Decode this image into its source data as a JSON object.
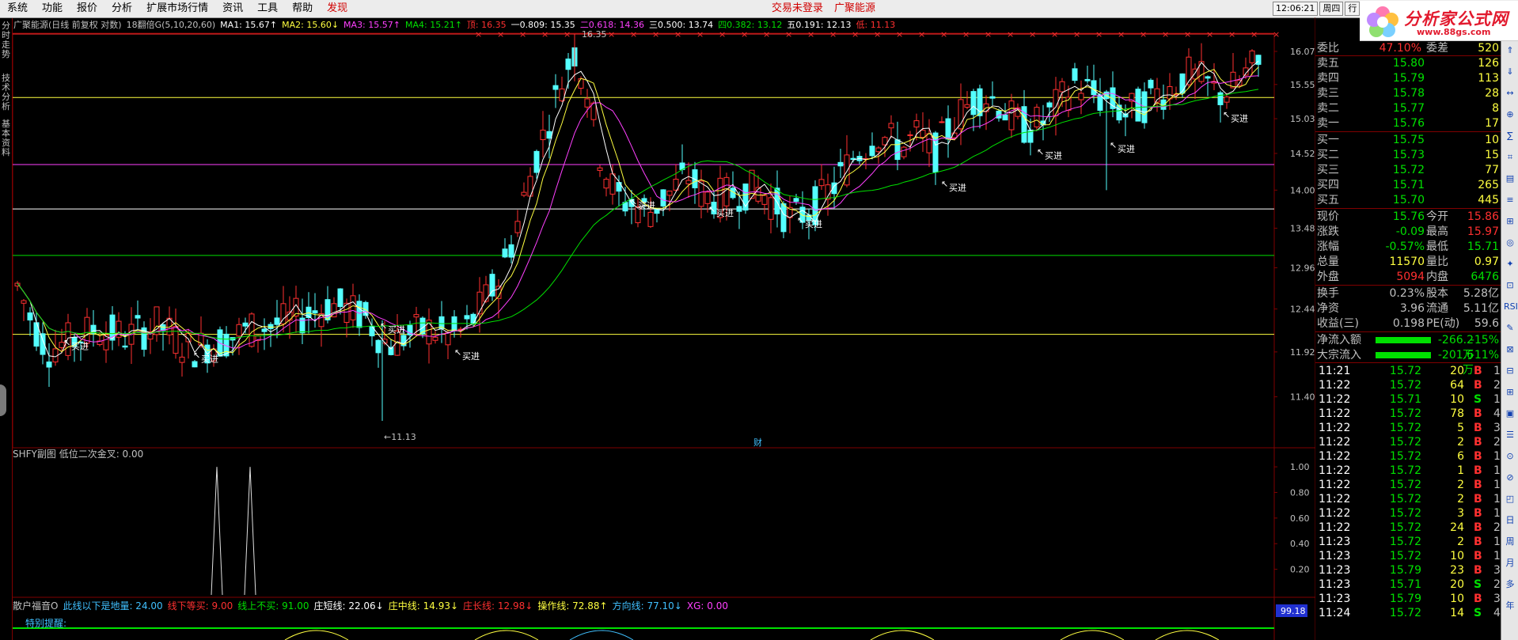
{
  "menu": [
    "系统",
    "功能",
    "报价",
    "分析",
    "扩展市场行情",
    "资讯",
    "工具",
    "帮助"
  ],
  "menu_discover": "发现",
  "menu_center": [
    "交易未登录",
    "广聚能源"
  ],
  "clock": {
    "time": "12:06:21",
    "weekday": "周四",
    "tab": "行"
  },
  "logo": {
    "title": "分析家公式网",
    "url": "www.88gs.com"
  },
  "left_tabs": [
    "分时走势",
    "技术分析",
    "基本资料"
  ],
  "header": {
    "stock": "广聚能源(日线 前复权 对数)",
    "rule": "18翻倍G(5,10,20,60)",
    "ma": [
      {
        "label": "MA1: 15.67",
        "arrow": "↑",
        "color": "#ffffff"
      },
      {
        "label": "MA2: 15.60",
        "arrow": "↓",
        "color": "#ffff40"
      },
      {
        "label": "MA3: 15.57",
        "arrow": "↑",
        "color": "#ff40ff"
      },
      {
        "label": "MA4: 15.21",
        "arrow": "↑",
        "color": "#00e000"
      }
    ],
    "levels": [
      {
        "label": "顶: 16.35",
        "color": "#ff3030"
      },
      {
        "label": "一0.809: 15.35",
        "color": "#ffffff"
      },
      {
        "label": "二0.618: 14.36",
        "color": "#ff40ff"
      },
      {
        "label": "三0.500: 13.74",
        "color": "#ffffff"
      },
      {
        "label": "四0.382: 13.12",
        "color": "#00e000"
      },
      {
        "label": "五0.191: 12.13",
        "color": "#ffffff"
      },
      {
        "label": "低: 11.13",
        "color": "#ff3030"
      }
    ]
  },
  "price_axis": [
    "16.07",
    "15.55",
    "15.03",
    "14.52",
    "14.00",
    "13.48",
    "12.96",
    "12.44",
    "11.92",
    "11.40"
  ],
  "annotations": {
    "high": "16.35",
    "low": "←11.13",
    "buy": "买进",
    "cai": "财"
  },
  "indicator1": {
    "title": "SHFY副图 低位二次金叉: 0.00",
    "axis": [
      "1.00",
      "0.80",
      "0.60",
      "0.40",
      "0.20"
    ]
  },
  "indicator2": {
    "items": [
      {
        "label": "散户福音O",
        "color": "#c0c0c0"
      },
      {
        "label": "此线以下是地量: 24.00",
        "color": "#40c0ff"
      },
      {
        "label": "线下等买: 9.00",
        "color": "#ff3030"
      },
      {
        "label": "线上不买: 91.00",
        "color": "#00e000"
      },
      {
        "label": "庄短线: 22.06↓",
        "color": "#ffffff"
      },
      {
        "label": "庄中线: 14.93↓",
        "color": "#ffff40"
      },
      {
        "label": "庄长线: 12.98↓",
        "color": "#ff3030"
      },
      {
        "label": "操作线: 72.88↑",
        "color": "#ffff40"
      },
      {
        "label": "方向线: 77.10↓",
        "color": "#40c0ff"
      },
      {
        "label": "XG: 0.00",
        "color": "#ff40ff"
      }
    ],
    "remind": "特别提醒:",
    "value_box": "99.18"
  },
  "quote": {
    "weibi": {
      "label": "委比",
      "value": "47.10%",
      "label2": "委差",
      "value2": "520"
    },
    "asks": [
      {
        "label": "卖五",
        "price": "15.80",
        "vol": "126"
      },
      {
        "label": "卖四",
        "price": "15.79",
        "vol": "113"
      },
      {
        "label": "卖三",
        "price": "15.78",
        "vol": "28"
      },
      {
        "label": "卖二",
        "price": "15.77",
        "vol": "8"
      },
      {
        "label": "卖一",
        "price": "15.76",
        "vol": "17"
      }
    ],
    "bids": [
      {
        "label": "买一",
        "price": "15.75",
        "vol": "10"
      },
      {
        "label": "买二",
        "price": "15.73",
        "vol": "15"
      },
      {
        "label": "买三",
        "price": "15.72",
        "vol": "77"
      },
      {
        "label": "买四",
        "price": "15.71",
        "vol": "265"
      },
      {
        "label": "买五",
        "price": "15.70",
        "vol": "445"
      }
    ],
    "stats": [
      {
        "l1": "现价",
        "v1": "15.76",
        "c1": "#00e000",
        "l2": "今开",
        "v2": "15.86",
        "c2": "#ff3030"
      },
      {
        "l1": "涨跌",
        "v1": "-0.09",
        "c1": "#00e000",
        "l2": "最高",
        "v2": "15.97",
        "c2": "#ff3030"
      },
      {
        "l1": "涨幅",
        "v1": "-0.57%",
        "c1": "#00e000",
        "l2": "最低",
        "v2": "15.71",
        "c2": "#00e000"
      },
      {
        "l1": "总量",
        "v1": "11570",
        "c1": "#ffff40",
        "l2": "量比",
        "v2": "0.97",
        "c2": "#ffff40"
      },
      {
        "l1": "外盘",
        "v1": "5094",
        "c1": "#ff3030",
        "l2": "内盘",
        "v2": "6476",
        "c2": "#00e000"
      }
    ],
    "stats2": [
      {
        "l1": "换手",
        "v1": "0.23%",
        "c1": "#c0c0c0",
        "l2": "股本",
        "v2": "5.28亿",
        "c2": "#c0c0c0"
      },
      {
        "l1": "净资",
        "v1": "3.96",
        "c1": "#c0c0c0",
        "l2": "流通",
        "v2": "5.11亿",
        "c2": "#c0c0c0"
      },
      {
        "l1": "收益(三)",
        "v1": "0.198",
        "c1": "#c0c0c0",
        "l2": "PE(动)",
        "v2": "59.6",
        "c2": "#c0c0c0"
      }
    ],
    "flows": [
      {
        "label": "净流入额",
        "value": "-266.2万",
        "pct": "-15%"
      },
      {
        "label": "大宗流入",
        "value": "-201.6万",
        "pct": "-11%"
      }
    ]
  },
  "ticks": [
    {
      "t": "11:21",
      "p": "15.72",
      "v": "20",
      "s": "B",
      "n": "1"
    },
    {
      "t": "11:22",
      "p": "15.72",
      "v": "64",
      "s": "B",
      "n": "2"
    },
    {
      "t": "11:22",
      "p": "15.71",
      "v": "10",
      "s": "S",
      "n": "1"
    },
    {
      "t": "11:22",
      "p": "15.72",
      "v": "78",
      "s": "B",
      "n": "4"
    },
    {
      "t": "11:22",
      "p": "15.72",
      "v": "5",
      "s": "B",
      "n": "3"
    },
    {
      "t": "11:22",
      "p": "15.72",
      "v": "2",
      "s": "B",
      "n": "2"
    },
    {
      "t": "11:22",
      "p": "15.72",
      "v": "6",
      "s": "B",
      "n": "1"
    },
    {
      "t": "11:22",
      "p": "15.72",
      "v": "1",
      "s": "B",
      "n": "1"
    },
    {
      "t": "11:22",
      "p": "15.72",
      "v": "2",
      "s": "B",
      "n": "1"
    },
    {
      "t": "11:22",
      "p": "15.72",
      "v": "2",
      "s": "B",
      "n": "1"
    },
    {
      "t": "11:22",
      "p": "15.72",
      "v": "3",
      "s": "B",
      "n": "1"
    },
    {
      "t": "11:22",
      "p": "15.72",
      "v": "24",
      "s": "B",
      "n": "2"
    },
    {
      "t": "11:23",
      "p": "15.72",
      "v": "2",
      "s": "B",
      "n": "1"
    },
    {
      "t": "11:23",
      "p": "15.72",
      "v": "10",
      "s": "B",
      "n": "1"
    },
    {
      "t": "11:23",
      "p": "15.79",
      "v": "23",
      "s": "B",
      "n": "3"
    },
    {
      "t": "11:23",
      "p": "15.71",
      "v": "20",
      "s": "S",
      "n": "2"
    },
    {
      "t": "11:23",
      "p": "15.79",
      "v": "10",
      "s": "B",
      "n": "3"
    },
    {
      "t": "11:24",
      "p": "15.72",
      "v": "14",
      "s": "S",
      "n": "4"
    }
  ],
  "right_tools": [
    "⇑",
    "⇓",
    "↔",
    "⊕",
    "∑",
    "⌗",
    "▤",
    "≡",
    "⊞",
    "◎",
    "✦",
    "⊡",
    "RSI",
    "✎",
    "⊠",
    "⊟",
    "⊞",
    "▣",
    "☰",
    "⊙",
    "⊘",
    "◰",
    "日",
    "周",
    "月",
    "多",
    "年"
  ]
}
